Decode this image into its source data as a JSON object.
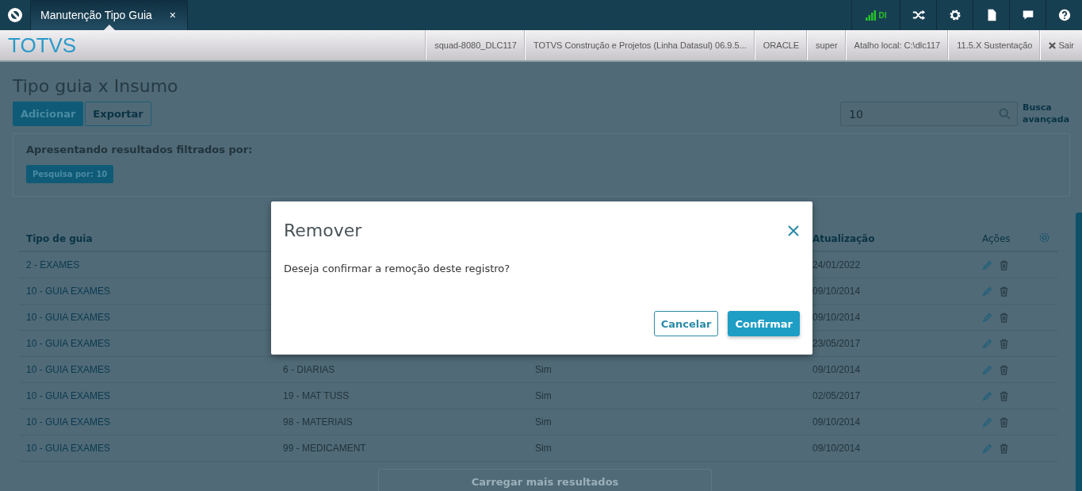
{
  "top_bar": {
    "tab": {
      "label": "Manutenção Tipo Guia",
      "close": "×",
      "selected": true
    },
    "status_text": "DI"
  },
  "header": {
    "brand": "TOTVS",
    "info": [
      "squad-8080_DLC117",
      "TOTVS Construção e Projetos (Linha Datasul) 06.9.5...",
      "ORACLE",
      "super",
      "Atalho local: C:\\dlc117",
      "11.5.X Sustentação"
    ],
    "logout": "Sair"
  },
  "page": {
    "title": "Tipo guia x Insumo",
    "actions": [
      {
        "label": "Adicionar",
        "kind": "primary"
      },
      {
        "label": "Exportar",
        "kind": "secondary"
      }
    ],
    "search": {
      "value": "10"
    },
    "advanced_search": "Busca avançada",
    "filter": {
      "heading": "Apresentando resultados filtrados por:",
      "tags": [
        "Pesquisa por: 10"
      ]
    }
  },
  "table": {
    "columns": [
      {
        "label": "Tipo de guia"
      },
      {},
      {},
      {
        "label": "Atualização"
      },
      {
        "label": "Ações"
      }
    ],
    "rows": [
      {
        "cells": [
          "2 - EXAMES",
          null,
          null,
          "24/01/2022"
        ]
      },
      {
        "cells": [
          "10 - GUIA EXAMES",
          null,
          null,
          "09/10/2014"
        ]
      },
      {
        "cells": [
          "10 - GUIA EXAMES",
          null,
          null,
          "09/10/2014"
        ]
      },
      {
        "cells": [
          "10 - GUIA EXAMES",
          null,
          null,
          "23/05/2017"
        ]
      },
      {
        "cells": [
          "10 - GUIA EXAMES",
          "6 - DIARIAS",
          "Sim",
          "09/10/2014"
        ]
      },
      {
        "cells": [
          "10 - GUIA EXAMES",
          "19 - MAT TUSS",
          "Sim",
          "02/05/2017"
        ]
      },
      {
        "cells": [
          "10 - GUIA EXAMES",
          "98 - MATERIAIS",
          "Sim",
          "09/10/2014"
        ]
      },
      {
        "cells": [
          "10 - GUIA EXAMES",
          "99 - MEDICAMENT",
          "Sim",
          "09/10/2014"
        ]
      }
    ],
    "load_more": "Carregar mais resultados"
  },
  "modal": {
    "title": "Remover",
    "message": "Deseja confirmar a remoção deste registro?",
    "buttons": [
      {
        "label": "Cancelar",
        "kind": "secondary"
      },
      {
        "label": "Confirmar",
        "kind": "primary"
      }
    ]
  }
}
